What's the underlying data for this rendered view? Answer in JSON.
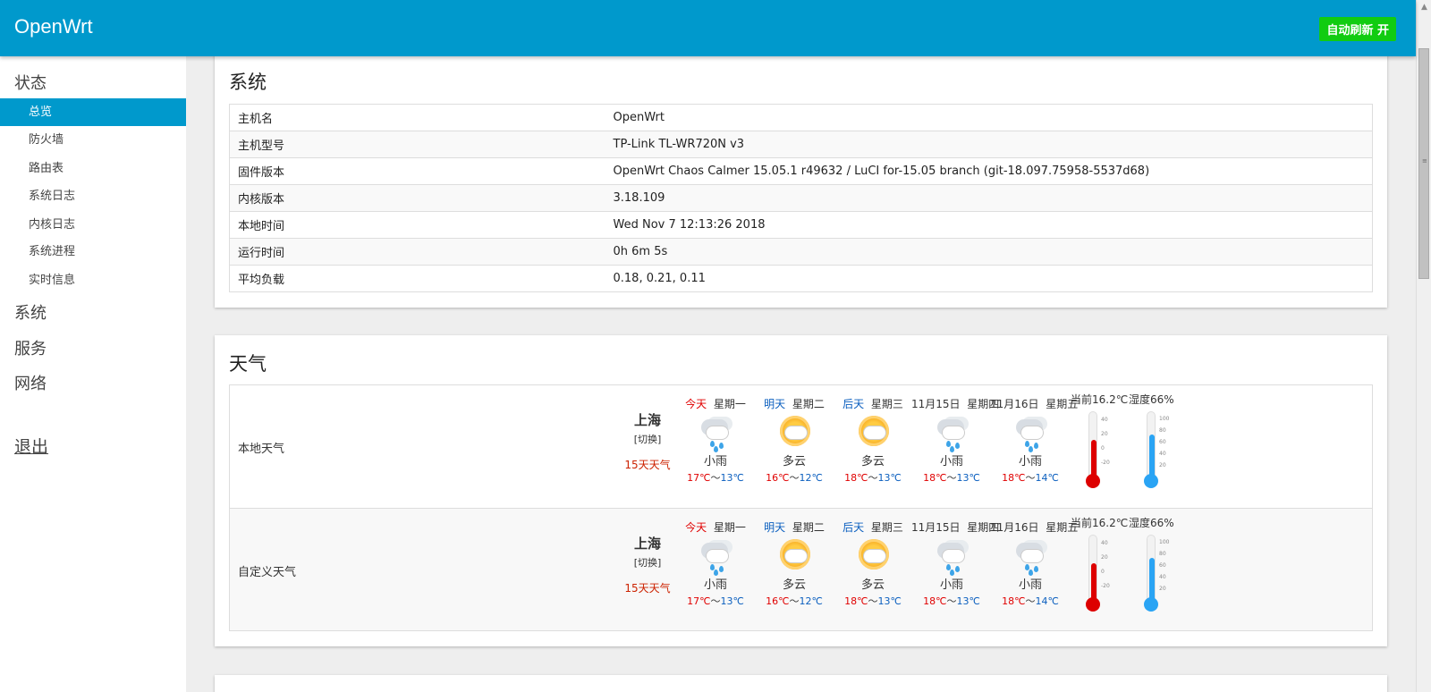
{
  "header": {
    "brand": "OpenWrt",
    "refresh": "自动刷新 开"
  },
  "sidebar": {
    "status": "状态",
    "items": [
      "总览",
      "防火墙",
      "路由表",
      "系统日志",
      "内核日志",
      "系统进程",
      "实时信息"
    ],
    "system": "系统",
    "services": "服务",
    "network": "网络",
    "logout": "退出"
  },
  "system_card": {
    "title": "系统",
    "rows": [
      {
        "k": "主机名",
        "v": "OpenWrt"
      },
      {
        "k": "主机型号",
        "v": "TP-Link TL-WR720N v3"
      },
      {
        "k": "固件版本",
        "v": "OpenWrt Chaos Calmer 15.05.1 r49632 / LuCI for-15.05 branch (git-18.097.75958-5537d68)"
      },
      {
        "k": "内核版本",
        "v": "3.18.109"
      },
      {
        "k": "本地时间",
        "v": "Wed Nov 7 12:13:26 2018"
      },
      {
        "k": "运行时间",
        "v": "0h 6m 5s"
      },
      {
        "k": "平均负载",
        "v": "0.18, 0.21, 0.11"
      }
    ]
  },
  "weather_card": {
    "title": "天气",
    "rows": [
      {
        "label": "本地天气"
      },
      {
        "label": "自定义天气"
      }
    ],
    "city": "上海",
    "switch": "[切换]",
    "fifteen": "15天天气",
    "days": [
      {
        "rel": "今天",
        "rel_color": "red",
        "week": "星期一",
        "icon": "rain-cloud-icon",
        "cond": "小雨",
        "high": "17℃",
        "low": "13℃"
      },
      {
        "rel": "明天",
        "rel_color": "blue",
        "week": "星期二",
        "icon": "partly-cloudy-sun-icon",
        "cond": "多云",
        "high": "16℃",
        "low": "12℃"
      },
      {
        "rel": "后天",
        "rel_color": "blue",
        "week": "星期三",
        "icon": "partly-cloudy-sun-icon",
        "cond": "多云",
        "high": "18℃",
        "low": "13℃"
      },
      {
        "rel": "11月15日",
        "rel_color": "",
        "week": "星期四",
        "icon": "rain-cloud-icon",
        "cond": "小雨",
        "high": "18℃",
        "low": "13℃"
      },
      {
        "rel": "11月16日",
        "rel_color": "",
        "week": "星期五",
        "icon": "rain-cloud-icon",
        "cond": "小雨",
        "high": "18℃",
        "low": "14℃"
      }
    ],
    "separator": "～",
    "current_temp": "当前16.2℃",
    "humidity": "湿度66%",
    "temp_scale": [
      "40",
      "20",
      "0",
      "-20"
    ],
    "hum_scale": [
      "100",
      "80",
      "60",
      "40",
      "20"
    ],
    "temp_value": 16.2,
    "humidity_value": 66,
    "colors": {
      "red": "#e00000",
      "blue": "#0b5fbf",
      "thermo": "#dd0000",
      "hygro": "#2aa4f4",
      "accent": "#0099cc"
    }
  }
}
